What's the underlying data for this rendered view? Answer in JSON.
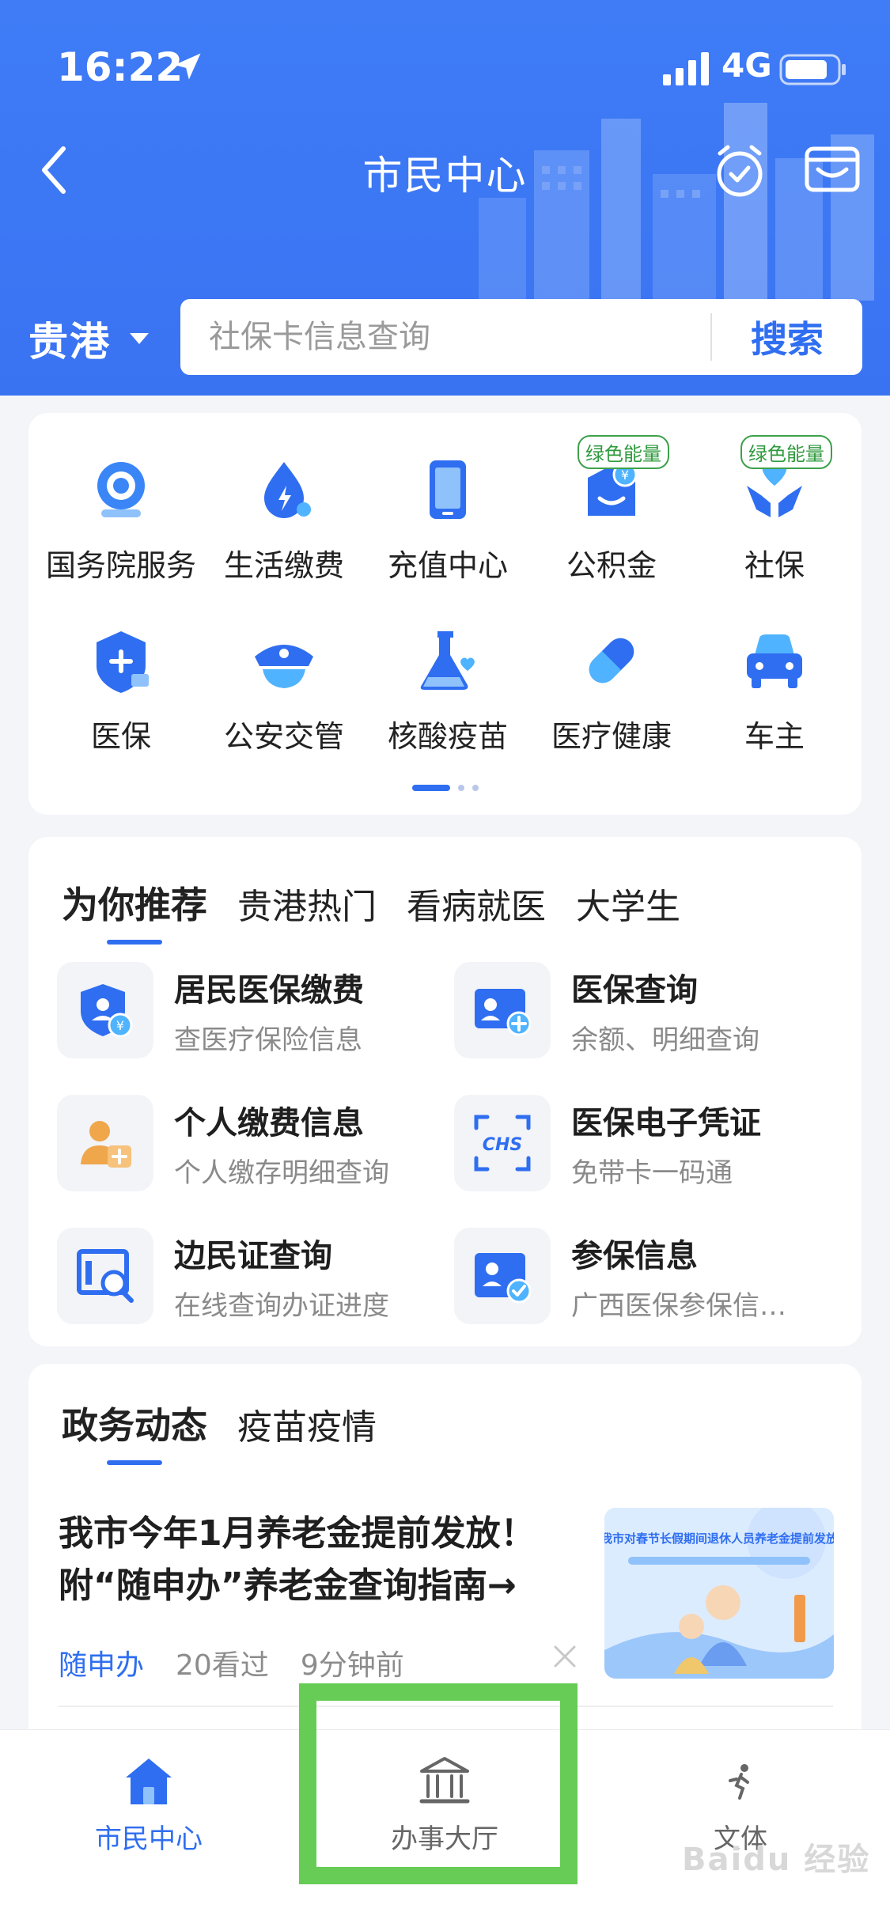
{
  "status_bar": {
    "time": "16:22",
    "network": "4G"
  },
  "header": {
    "title": "市民中心",
    "city": "贵港"
  },
  "search": {
    "placeholder": "社保卡信息查询",
    "button_label": "搜索"
  },
  "services": {
    "badge_label": "绿色能量",
    "items": [
      {
        "label": "国务院服务",
        "icon": "state-council-icon",
        "badge": false
      },
      {
        "label": "生活缴费",
        "icon": "utility-payment-icon",
        "badge": false
      },
      {
        "label": "充值中心",
        "icon": "recharge-phone-icon",
        "badge": false
      },
      {
        "label": "公积金",
        "icon": "housing-fund-icon",
        "badge": true
      },
      {
        "label": "社保",
        "icon": "social-security-icon",
        "badge": true
      },
      {
        "label": "医保",
        "icon": "medical-insurance-icon",
        "badge": false
      },
      {
        "label": "公安交管",
        "icon": "police-cap-icon",
        "badge": false
      },
      {
        "label": "核酸疫苗",
        "icon": "flask-icon",
        "badge": false
      },
      {
        "label": "医疗健康",
        "icon": "pill-icon",
        "badge": false
      },
      {
        "label": "车主",
        "icon": "car-icon",
        "badge": false
      }
    ]
  },
  "recommend": {
    "tabs": [
      "为你推荐",
      "贵港热门",
      "看病就医",
      "大学生"
    ],
    "items": [
      {
        "title": "居民医保缴费",
        "subtitle": "查医疗保险信息",
        "icon": "medical-payment-icon"
      },
      {
        "title": "医保查询",
        "subtitle": "余额、明细查询",
        "icon": "medical-query-icon"
      },
      {
        "title": "个人缴费信息",
        "subtitle": "个人缴存明细查询",
        "icon": "personal-payment-icon"
      },
      {
        "title": "医保电子凭证",
        "subtitle": "免带卡一码通",
        "icon": "chs-code-icon"
      },
      {
        "title": "边民证查询",
        "subtitle": "在线查询办证进度",
        "icon": "border-pass-search-icon"
      },
      {
        "title": "参保信息",
        "subtitle": "广西医保参保信…",
        "icon": "insured-info-icon"
      }
    ]
  },
  "news": {
    "tabs": [
      "政务动态",
      "疫苗疫情"
    ],
    "title": "我市今年1月养老金提前发放！附“随申办”养老金查询指南→",
    "source": "随申办",
    "views": "20看过",
    "time": "9分钟前",
    "thumb_caption": "我市对春节长假期间退休人员养老金提前发放"
  },
  "bottom_nav": {
    "items": [
      {
        "label": "市民中心",
        "icon": "home-icon",
        "active": true
      },
      {
        "label": "办事大厅",
        "icon": "government-hall-icon",
        "active": false
      },
      {
        "label": "文体",
        "icon": "running-person-icon",
        "active": false
      }
    ]
  },
  "watermark": "Baidu 经验",
  "colors": {
    "primary": "#3a73f2",
    "accent_blue": "#2f6ef0",
    "energy_green": "#3da14a",
    "highlight": "#66cc55"
  }
}
